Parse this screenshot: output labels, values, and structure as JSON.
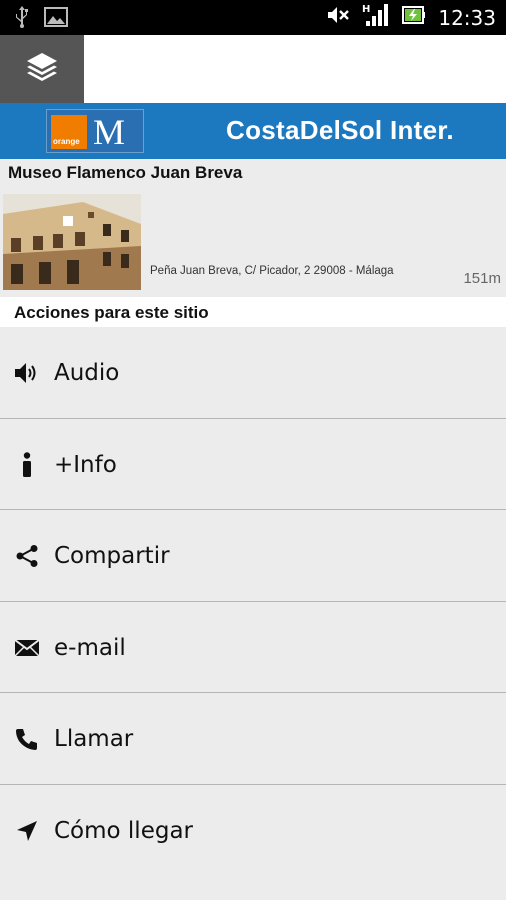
{
  "status_bar": {
    "time": "12:33",
    "icons": [
      "usb-icon",
      "image-icon",
      "mute-icon",
      "signal-icon",
      "battery-icon"
    ],
    "network_label": "H"
  },
  "toolbar": {
    "layers_icon": "layers-icon"
  },
  "banner": {
    "title": "CostaDelSol Inter.",
    "logo_text": "orange",
    "logo_letter": "M",
    "color": "#1c79c0"
  },
  "place": {
    "name": "Museo Flamenco Juan Breva",
    "address": "Peña Juan Breva, C/ Picador, 2 29008 - Málaga",
    "distance": "151m"
  },
  "actions_header": "Acciones para este sitio",
  "actions": [
    {
      "label": "Audio",
      "icon": "speaker-icon"
    },
    {
      "label": "+Info",
      "icon": "info-icon"
    },
    {
      "label": "Compartir",
      "icon": "share-icon"
    },
    {
      "label": "e-mail",
      "icon": "mail-icon"
    },
    {
      "label": "Llamar",
      "icon": "phone-icon"
    },
    {
      "label": "Cómo llegar",
      "icon": "navigation-icon"
    }
  ]
}
